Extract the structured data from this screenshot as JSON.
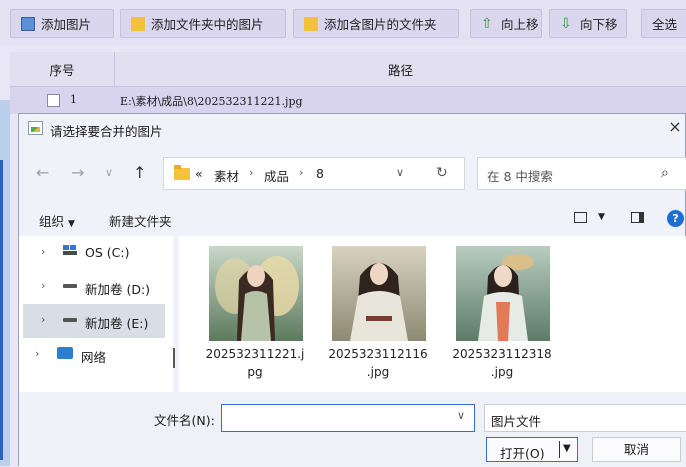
{
  "toolbar": {
    "buttons": [
      {
        "label": "添加图片"
      },
      {
        "label": "添加文件夹中的图片"
      },
      {
        "label": "添加含图片的文件夹"
      },
      {
        "label": "向上移"
      },
      {
        "label": "向下移"
      },
      {
        "label": "全选"
      }
    ]
  },
  "table": {
    "headers": [
      "序号",
      "路径"
    ],
    "rows": [
      {
        "index": "1",
        "path": "E:\\素材\\成品\\8\\202532311221.jpg"
      }
    ]
  },
  "dialog": {
    "title": "请选择要合并的图片",
    "close": "×",
    "address": {
      "prefix": "«",
      "crumbs": [
        "素材",
        "成品",
        "8"
      ],
      "separator": "›"
    },
    "search_placeholder": "在 8 中搜索",
    "commands": {
      "organize": "组织",
      "new_folder": "新建文件夹"
    },
    "help": "?",
    "nav_items": [
      {
        "label": "OS (C:)",
        "icon": "os-drive-icon",
        "selected": false
      },
      {
        "label": "新加卷 (D:)",
        "icon": "drive-icon",
        "selected": false
      },
      {
        "label": "新加卷 (E:)",
        "icon": "drive-icon",
        "selected": true
      },
      {
        "label": "网络",
        "icon": "network-icon",
        "selected": false
      }
    ],
    "files": [
      {
        "name_line1": "202532311221.j",
        "name_line2": "pg"
      },
      {
        "name_line1": "2025323112116",
        "name_line2": ".jpg"
      },
      {
        "name_line1": "2025323112318",
        "name_line2": ".jpg"
      }
    ],
    "filename_label": "文件名(N):",
    "filename_value": "",
    "filter": "图片文件",
    "open_label": "打开(O)",
    "cancel_label": "取消"
  },
  "colors": {
    "accent": "#3c6ad6",
    "help": "#1e6fd4",
    "toolbar_bg": "#e4e1f3",
    "row_selected": "#d8d3ee"
  }
}
